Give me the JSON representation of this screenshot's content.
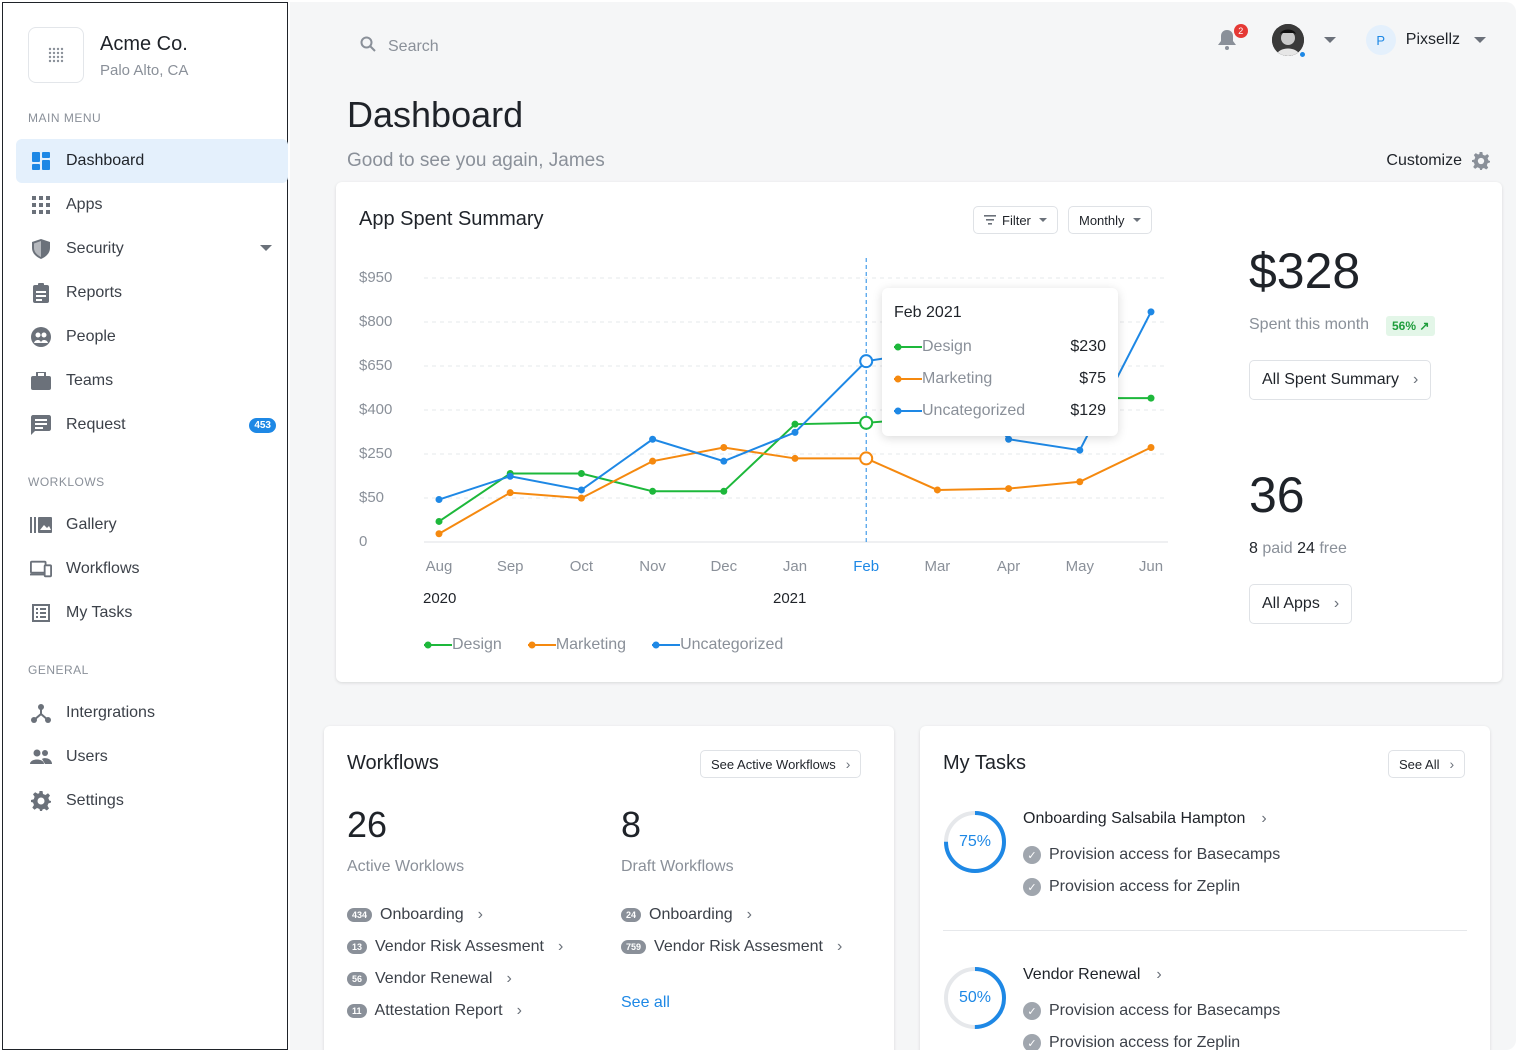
{
  "org": {
    "name": "Acme Co.",
    "location": "Palo Alto, CA"
  },
  "sidebar": {
    "main_menu_label": "MAIN MENU",
    "main_items": [
      {
        "label": "Dashboard",
        "icon": "dashboard-icon"
      },
      {
        "label": "Apps",
        "icon": "apps-grid-icon"
      },
      {
        "label": "Security",
        "icon": "shield-icon"
      },
      {
        "label": "Reports",
        "icon": "clipboard-icon"
      },
      {
        "label": "People",
        "icon": "people-icon"
      },
      {
        "label": "Teams",
        "icon": "briefcase-icon"
      },
      {
        "label": "Request",
        "icon": "message-icon",
        "badge": "453"
      }
    ],
    "workflows_label": "WORKLOWS",
    "workflow_items": [
      {
        "label": "Gallery",
        "icon": "gallery-icon"
      },
      {
        "label": "Workflows",
        "icon": "devices-icon"
      },
      {
        "label": "My Tasks",
        "icon": "tasks-icon"
      }
    ],
    "general_label": "GENERAL",
    "general_items": [
      {
        "label": "Intergrations",
        "icon": "integrations-icon"
      },
      {
        "label": "Users",
        "icon": "users-icon"
      },
      {
        "label": "Settings",
        "icon": "gear-icon"
      }
    ]
  },
  "header": {
    "search_placeholder": "Search",
    "notification_count": "2",
    "user_initial": "P",
    "user_name": "Pixsellz"
  },
  "page": {
    "title": "Dashboard",
    "subtitle": "Good to see you again, James",
    "customize_label": "Customize"
  },
  "spent_card": {
    "title": "App Spent Summary",
    "filter_label": "Filter",
    "period_label": "Monthly",
    "amount": "$328",
    "amount_label": "Spent this month",
    "change_pill": "56% ↗",
    "summary_button": "All Spent Summary",
    "apps_count": "36",
    "paid_count": "8",
    "paid_word": "paid",
    "free_count": "24",
    "free_word": "free",
    "apps_button": "All Apps"
  },
  "tooltip": {
    "title": "Feb 2021",
    "rows": [
      {
        "label": "Design",
        "value": "$230"
      },
      {
        "label": "Marketing",
        "value": "$75"
      },
      {
        "label": "Uncategorized",
        "value": "$129"
      }
    ]
  },
  "chart_data": {
    "type": "line",
    "title": "App Spent Summary",
    "categories": [
      "Aug",
      "Sep",
      "Oct",
      "Nov",
      "Dec",
      "Jan",
      "Feb",
      "Mar",
      "Apr",
      "May",
      "Jun"
    ],
    "year_labels": [
      "2020",
      "2021"
    ],
    "y_tick_labels": [
      "$950",
      "$800",
      "$650",
      "$400",
      "$250",
      "$50",
      "0"
    ],
    "highlighted_category": "Feb",
    "series": [
      {
        "name": "Design",
        "color": "#1db83b",
        "values": [
          75,
          250,
          250,
          185,
          185,
          430,
          435,
          455,
          400,
          525,
          525
        ]
      },
      {
        "name": "Marketing",
        "color": "#f5890f",
        "values": [
          30,
          180,
          160,
          295,
          345,
          305,
          305,
          190,
          195,
          220,
          345
        ]
      },
      {
        "name": "Uncategorized",
        "color": "#1e88e5",
        "values": [
          155,
          240,
          190,
          375,
          295,
          400,
          660,
          700,
          375,
          335,
          840
        ]
      }
    ],
    "legend": [
      "Design",
      "Marketing",
      "Uncategorized"
    ],
    "legend_position": "bottom-left",
    "grid": true
  },
  "workflows_card": {
    "title": "Workflows",
    "see_active_button": "See Active Workflows",
    "active_count": "26",
    "active_label": "Active Worklows",
    "draft_count": "8",
    "draft_label": "Draft Workflows",
    "active_items": [
      {
        "badge": "434",
        "label": "Onboarding"
      },
      {
        "badge": "13",
        "label": "Vendor Risk Assesment"
      },
      {
        "badge": "56",
        "label": "Vendor Renewal"
      },
      {
        "badge": "11",
        "label": "Attestation Report"
      }
    ],
    "draft_items": [
      {
        "badge": "24",
        "label": "Onboarding"
      },
      {
        "badge": "759",
        "label": "Vendor Risk Assesment"
      }
    ],
    "see_all_label": "See all"
  },
  "tasks_card": {
    "title": "My Tasks",
    "see_all_button": "See All",
    "tasks": [
      {
        "progress_label": "75%",
        "progress": 0.75,
        "title": "Onboarding Salsabila Hampton",
        "subtasks": [
          "Provision access for Basecamps",
          "Provision access for Zeplin"
        ]
      },
      {
        "progress_label": "50%",
        "progress": 0.5,
        "title": "Vendor Renewal",
        "subtasks": [
          "Provision access for Basecamps",
          "Provision access for Zeplin"
        ]
      }
    ]
  }
}
